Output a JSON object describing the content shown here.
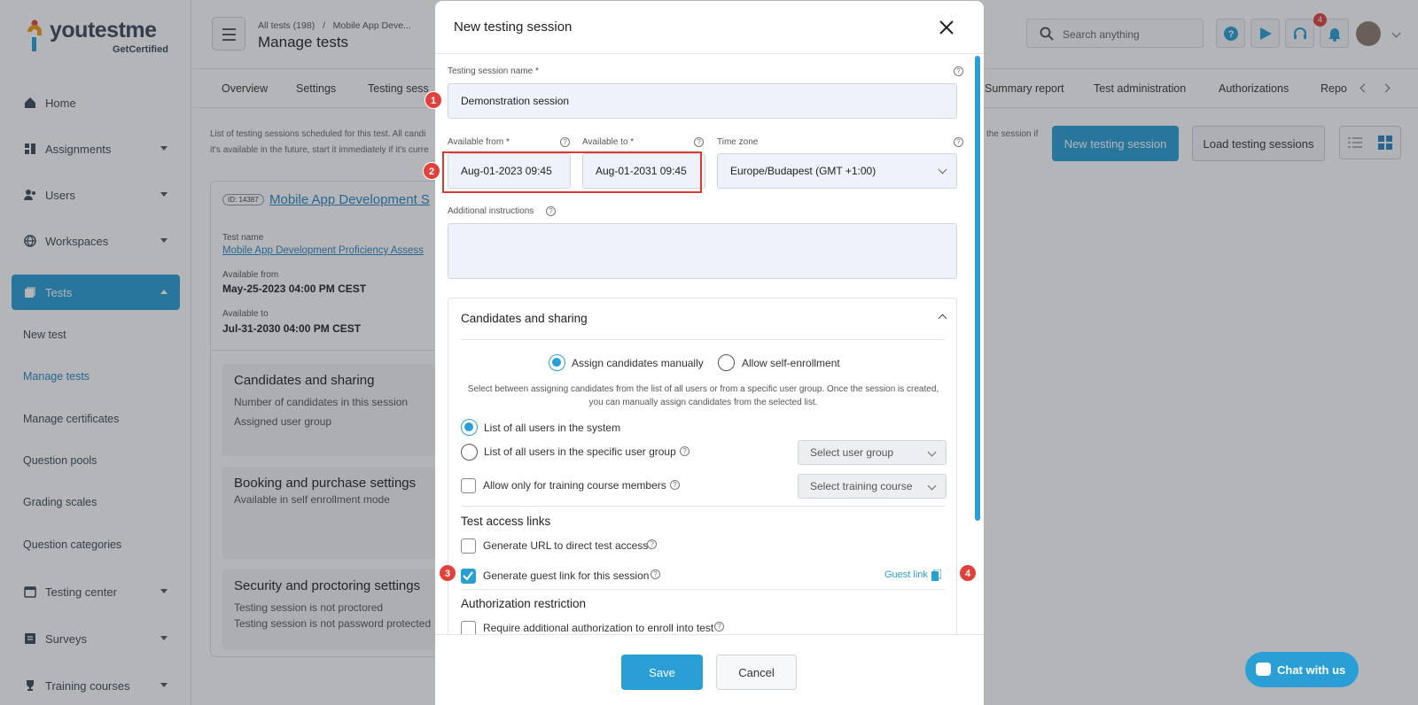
{
  "brand": {
    "name": "youtestme",
    "sub": "GetCertified"
  },
  "sidebar": {
    "items": [
      {
        "label": "Home"
      },
      {
        "label": "Assignments"
      },
      {
        "label": "Users"
      },
      {
        "label": "Workspaces"
      },
      {
        "label": "Tests"
      },
      {
        "label": "Testing center"
      },
      {
        "label": "Surveys"
      },
      {
        "label": "Training courses"
      }
    ],
    "sub_items": [
      "New test",
      "Manage tests",
      "Manage certificates",
      "Question pools",
      "Grading scales",
      "Question categories"
    ]
  },
  "header": {
    "breadcrumb_root": "All tests (198)",
    "breadcrumb_sep": "/",
    "breadcrumb_current": "Mobile App Deve...",
    "title": "Manage tests",
    "search_placeholder": "Search anything",
    "notification_count": "4"
  },
  "tabs": [
    "Overview",
    "Settings",
    "Testing sess",
    "Summary report",
    "Test administration",
    "Authorizations",
    "Repo"
  ],
  "description": {
    "line1": "List of testing sessions scheduled for this test. All candi",
    "line2": "it's available in the future, start it immediately if it's curre",
    "right": "the session if"
  },
  "actions": {
    "new_session": "New testing session",
    "load_sessions": "Load testing sessions"
  },
  "card": {
    "id": "ID: 14387",
    "title": "Mobile App Development S",
    "test_name_label": "Test name",
    "test_name": "Mobile App Development Proficiency Assess",
    "available_from_label": "Available from",
    "available_from": "May-25-2023 04:00 PM CEST",
    "available_to_label": "Available to",
    "available_to": "Jul-31-2030 04:00 PM CEST",
    "sections": [
      {
        "title": "Candidates and sharing",
        "lines": [
          "Number of candidates in this session",
          "Assigned user group"
        ]
      },
      {
        "title": "Booking and purchase settings",
        "lines": [
          "Available in self enrollment mode"
        ]
      },
      {
        "title": "Security and proctoring settings",
        "lines": [
          "Testing session is not proctored",
          "Testing session is not password protected"
        ]
      }
    ]
  },
  "modal": {
    "title": "New testing session",
    "name_label": "Testing session name *",
    "name_value": "Demonstration session",
    "from_label": "Available from *",
    "from_value": "Aug-01-2023 09:45",
    "to_label": "Available to *",
    "to_value": "Aug-01-2031 09:45",
    "tz_label": "Time zone",
    "tz_value": "Europe/Budapest (GMT +1:00)",
    "instructions_label": "Additional instructions",
    "instructions_value": "",
    "candidates": {
      "title": "Candidates and sharing",
      "assign_manual": "Assign candidates manually",
      "self_enroll": "Allow self-enrollment",
      "hint": "Select between assigning candidates from the list of all users or from a specific user group. Once the session is created, you can manually assign candidates from the selected list.",
      "all_users": "List of all users in the system",
      "group_users": "List of all users in the specific user group",
      "select_group": "Select user group",
      "training_only": "Allow only for training course members",
      "select_training": "Select training course"
    },
    "links": {
      "title": "Test access links",
      "generate_url": "Generate URL to direct test access",
      "guest_link_option": "Generate guest link for this session",
      "guest_link": "Guest link"
    },
    "auth": {
      "title": "Authorization restriction",
      "require": "Require additional authorization to enroll into test"
    },
    "save": "Save",
    "cancel": "Cancel"
  },
  "markers": [
    "1",
    "2",
    "3",
    "4"
  ],
  "chat": "Chat with us",
  "colors": {
    "accent": "#2a9fd6",
    "marker": "#e0413a",
    "highlight": "#d93b32"
  }
}
